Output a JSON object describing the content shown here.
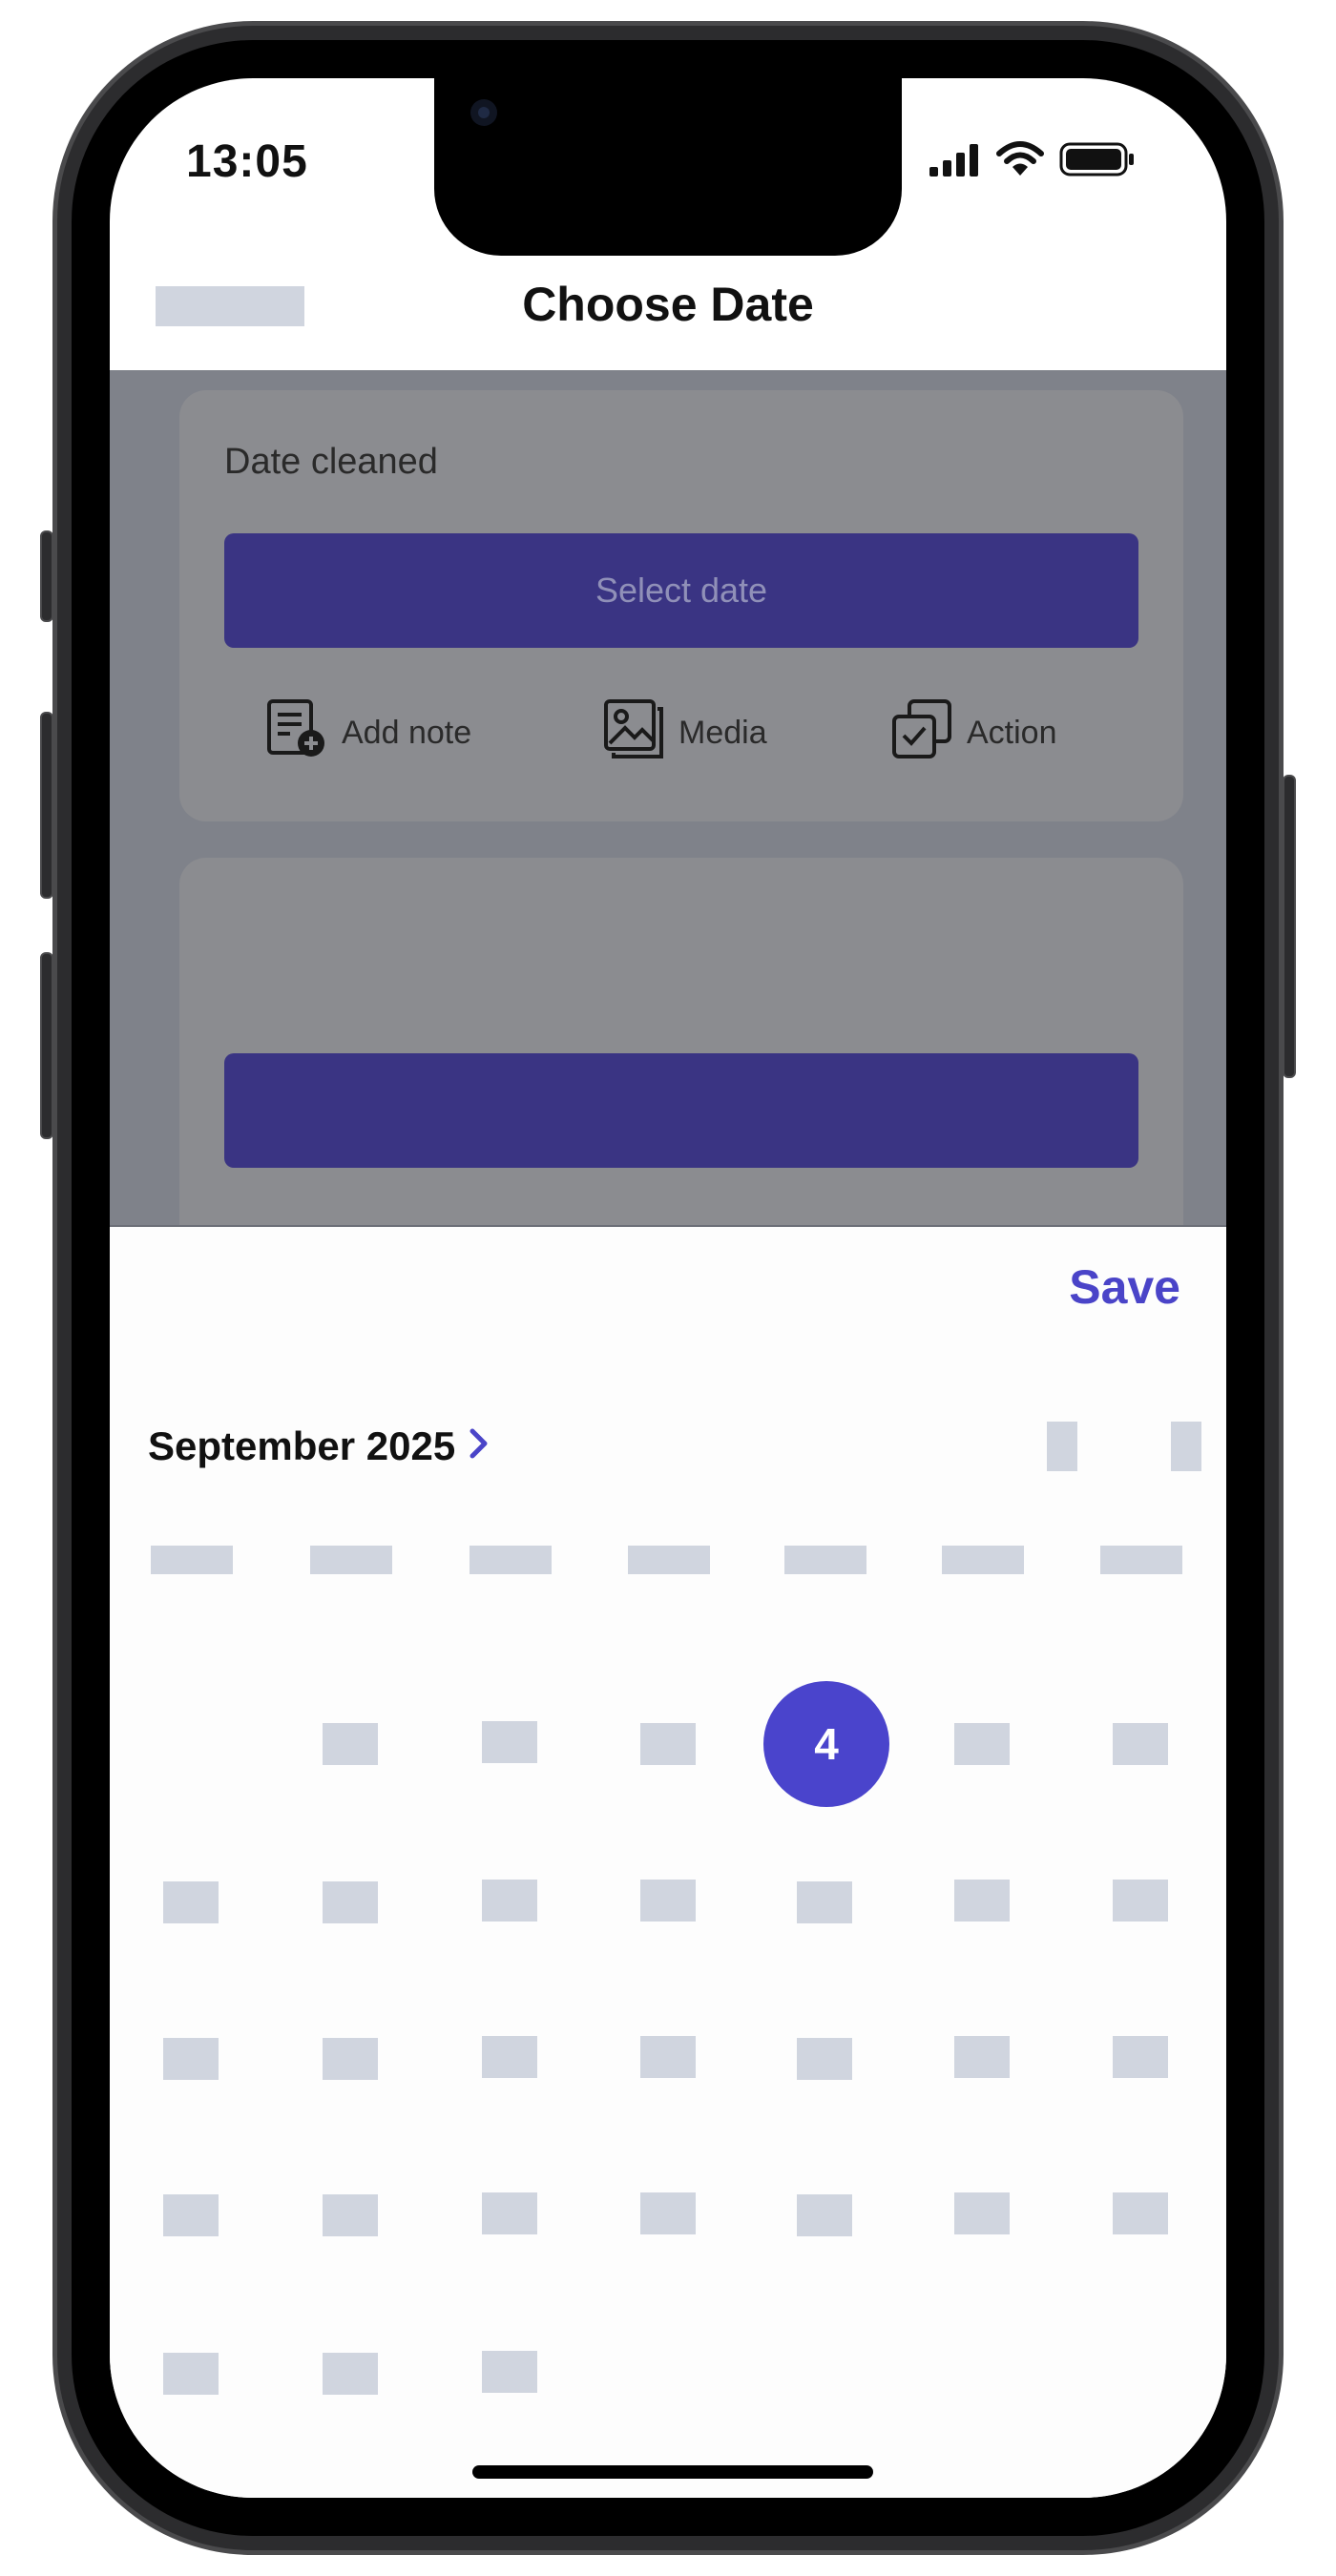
{
  "status_bar": {
    "time": "13:05"
  },
  "nav": {
    "title": "Choose Date"
  },
  "card": {
    "label": "Date cleaned",
    "select_button": "Select date",
    "actions": [
      {
        "label": "Add note",
        "icon": "add-note-icon"
      },
      {
        "label": "Media",
        "icon": "image-icon"
      },
      {
        "label": "Action",
        "icon": "checkbox-copy-icon"
      }
    ]
  },
  "picker": {
    "save_label": "Save",
    "month_label": "September 2025",
    "month_chevron": "›",
    "selected_day": "4"
  },
  "colors": {
    "accent": "#4A44CC",
    "button": "#3A3483",
    "overlay": "#7F828A",
    "placeholder": "#D0D5DF"
  }
}
